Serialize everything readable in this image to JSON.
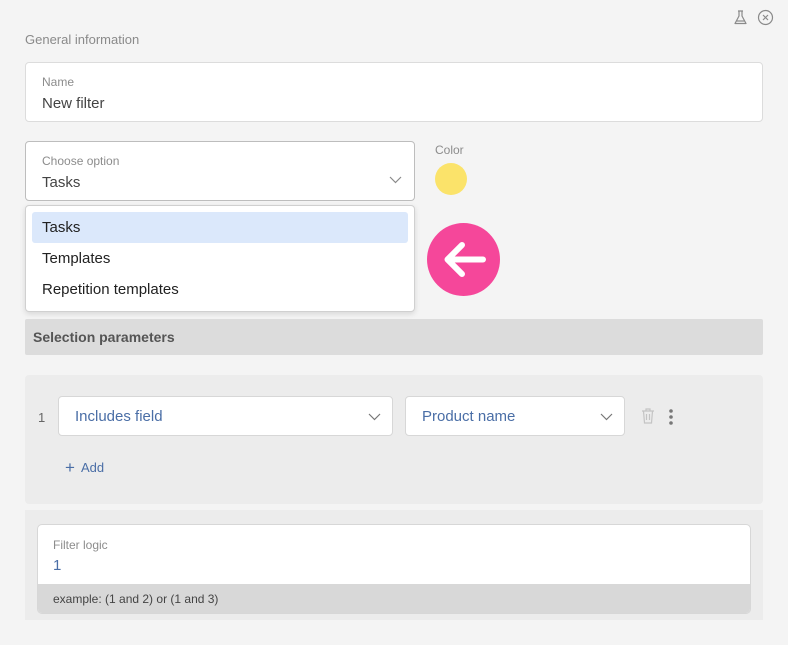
{
  "header": {
    "section_title": "General information",
    "icons": [
      "flask-icon",
      "close-circle-icon"
    ]
  },
  "name_field": {
    "label": "Name",
    "value": "New filter"
  },
  "type_select": {
    "label": "Choose option",
    "value": "Tasks",
    "options": [
      "Tasks",
      "Templates",
      "Repetition templates"
    ],
    "highlighted_option": "Tasks"
  },
  "color": {
    "label": "Color",
    "value": "#fbe36a"
  },
  "annotation": {
    "icon": "arrow-left-icon",
    "color": "#f5479a"
  },
  "selection_parameters": {
    "title": "Selection parameters",
    "rows": [
      {
        "number": "1",
        "condition": "Includes field",
        "field": "Product name"
      }
    ],
    "add_label": "Add"
  },
  "filter_logic": {
    "label": "Filter logic",
    "value": "1",
    "hint": "example: (1 and 2) or (1 and 3)"
  }
}
